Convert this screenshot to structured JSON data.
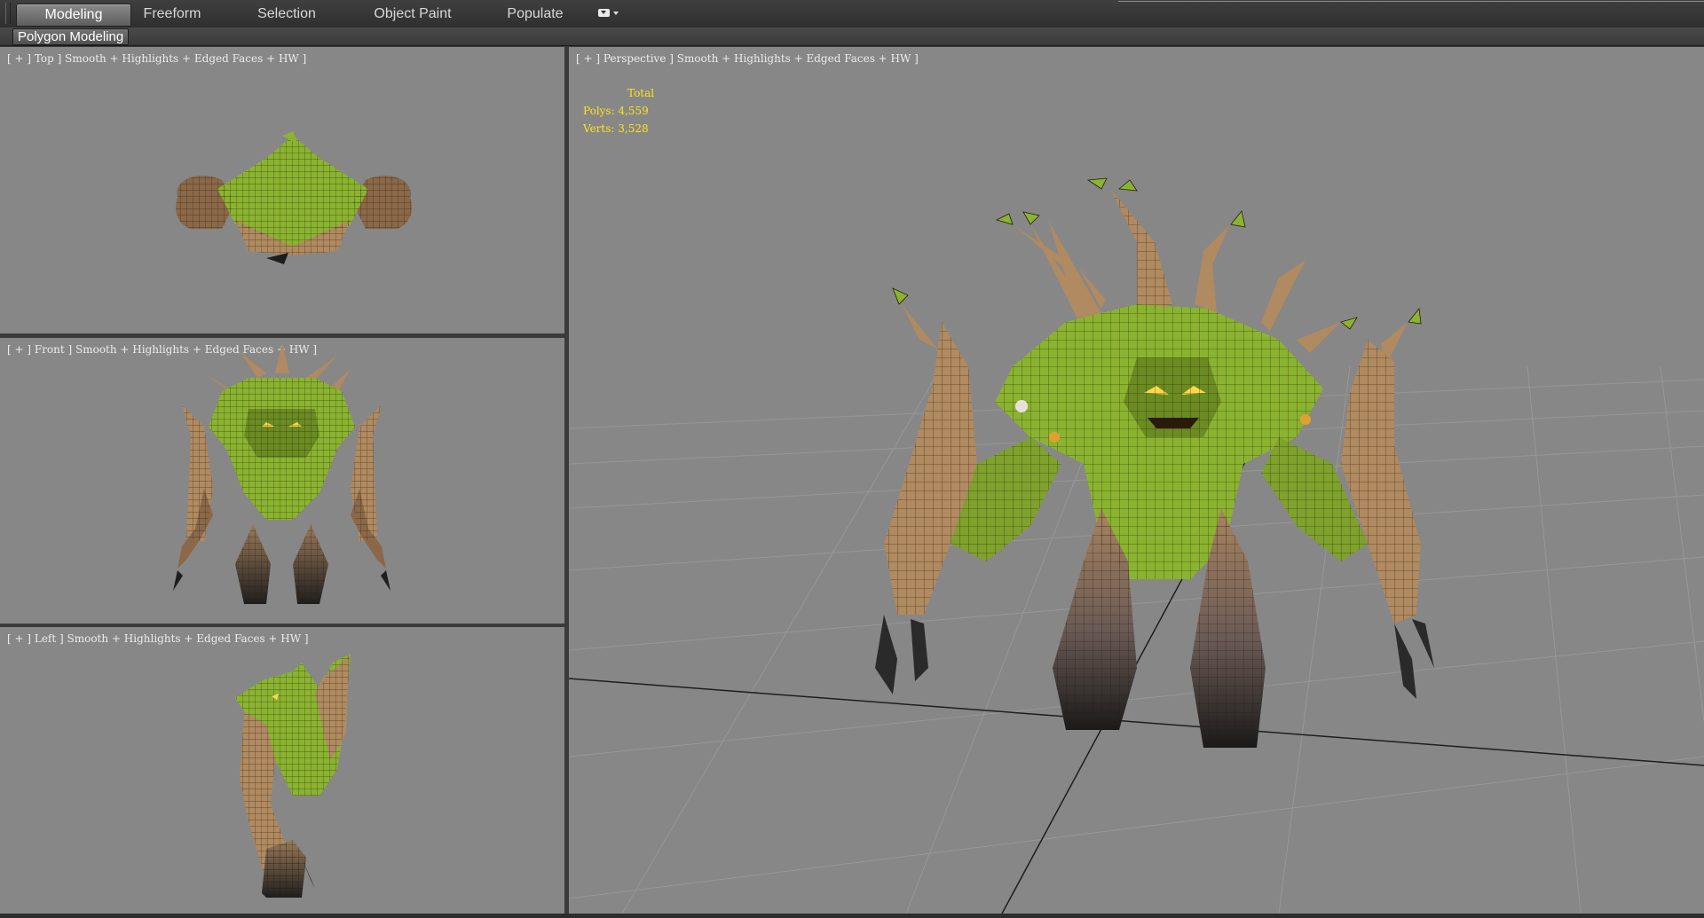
{
  "ribbon": {
    "tabs": [
      {
        "label": "Modeling",
        "active": true
      },
      {
        "label": "Freeform",
        "active": false
      },
      {
        "label": "Selection",
        "active": false
      },
      {
        "label": "Object Paint",
        "active": false
      },
      {
        "label": "Populate",
        "active": false
      }
    ],
    "panel_button": "Polygon Modeling"
  },
  "viewports": {
    "top": {
      "label": "[ + ] Top ] Smooth + Highlights + Edged Faces + HW ]"
    },
    "front": {
      "label": "[ + ] Front ] Smooth + Highlights + Edged Faces + HW ]"
    },
    "left": {
      "label": "[ + ] Left ] Smooth + Highlights + Edged Faces + HW ]"
    },
    "perspective": {
      "label": "[ + ] Perspective ] Smooth + Highlights + Edged Faces + HW ]"
    }
  },
  "stats": {
    "title": "Total",
    "polys": "Polys: 4,559",
    "verts": "Verts: 3,528"
  },
  "colors": {
    "viewport_bg": "#878787",
    "stats_text": "#ffe21a",
    "active_border": "#c8c8c8",
    "model_bark": "#b08a60",
    "model_moss": "#8ab430",
    "model_wire": "#2a1a0a"
  },
  "icons": [
    "tab-dropdown-icon"
  ]
}
